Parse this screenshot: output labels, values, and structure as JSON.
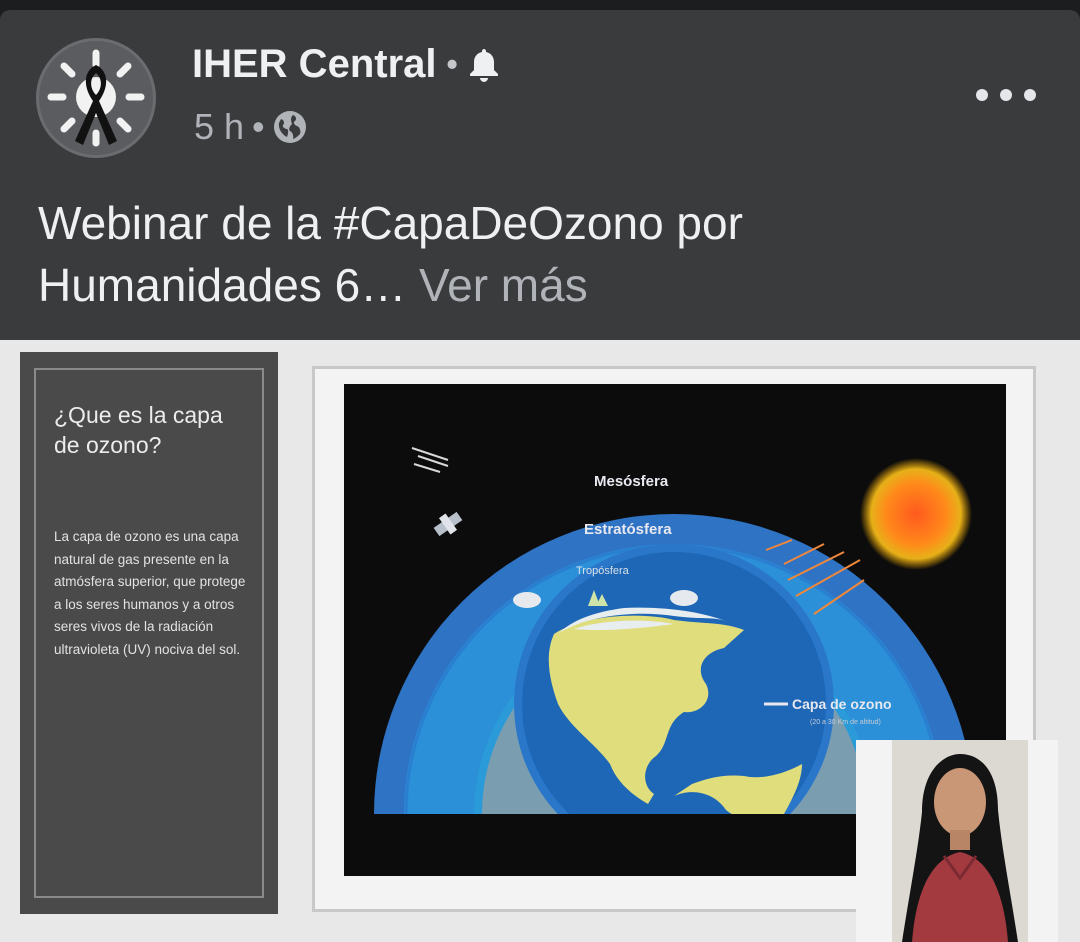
{
  "post": {
    "page_name": "IHER Central",
    "separator": "•",
    "time": "5 h",
    "icons": {
      "bell": "bell-icon",
      "globe": "globe-icon",
      "more": "more-options-icon"
    },
    "caption": "Webinar de la #CapaDeOzono por Humanidades 6…",
    "ver_mas": "Ver más"
  },
  "slide": {
    "title": "¿Que es la capa de ozono?",
    "body": "La capa de ozono es una capa natural de gas presente en la atmósfera superior, que protege a los seres humanos y a otros seres vivos de la radiación ultravioleta (UV) nociva del sol.",
    "diagram": {
      "mesosfera": "Mesósfera",
      "estratosfera": "Estratósfera",
      "troposfera": "Tropósfera",
      "ozono": "Capa de ozono",
      "ozono_note": "(20 a 30 Km de altitud)"
    }
  }
}
